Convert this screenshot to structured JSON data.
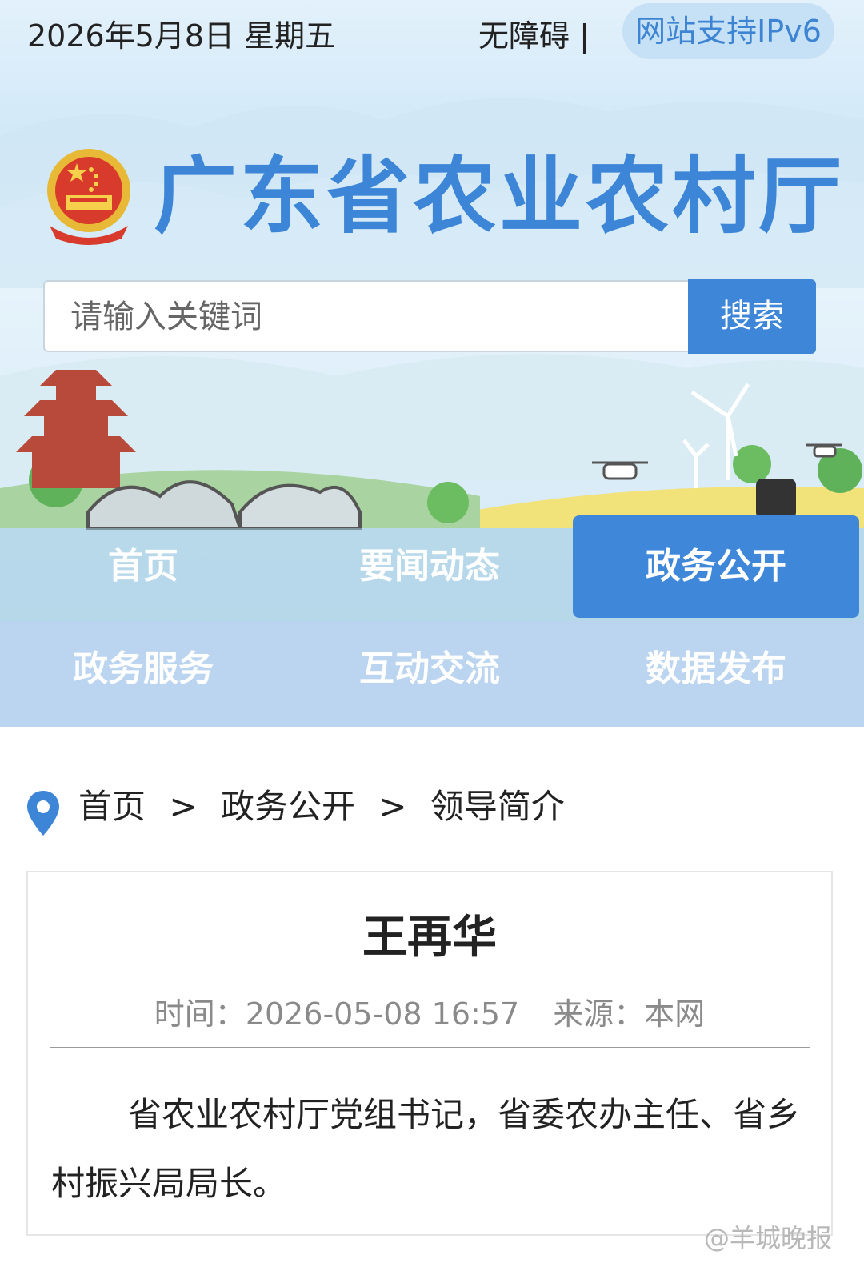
{
  "topbar": {
    "date": "2026年5月8日 星期五",
    "accessibility": "无障碍 |",
    "ipv6": "网站支持IPv6"
  },
  "site": {
    "title": "广东省农业农村厅"
  },
  "search": {
    "placeholder": "请输入关键词",
    "button": "搜索"
  },
  "nav": {
    "items": [
      {
        "label": "首页",
        "active": false
      },
      {
        "label": "要闻动态",
        "active": false
      },
      {
        "label": "政务公开",
        "active": true
      },
      {
        "label": "政务服务",
        "active": false
      },
      {
        "label": "互动交流",
        "active": false
      },
      {
        "label": "数据发布",
        "active": false
      }
    ]
  },
  "breadcrumb": {
    "items": [
      "首页",
      ">",
      "政务公开",
      ">",
      "领导简介"
    ]
  },
  "article": {
    "title": "王再华",
    "time_label": "时间：",
    "time": "2026-05-08 16:57",
    "source_label": "来源：",
    "source": "本网",
    "body": "省农业农村厅党组书记，省委农办主任、省乡村振兴局局长。"
  },
  "watermark": "@羊城晚报",
  "colors": {
    "accent": "#3d85d6",
    "nav_active": "#3f87d8",
    "ipv6_bg": "#c6e0f6"
  }
}
